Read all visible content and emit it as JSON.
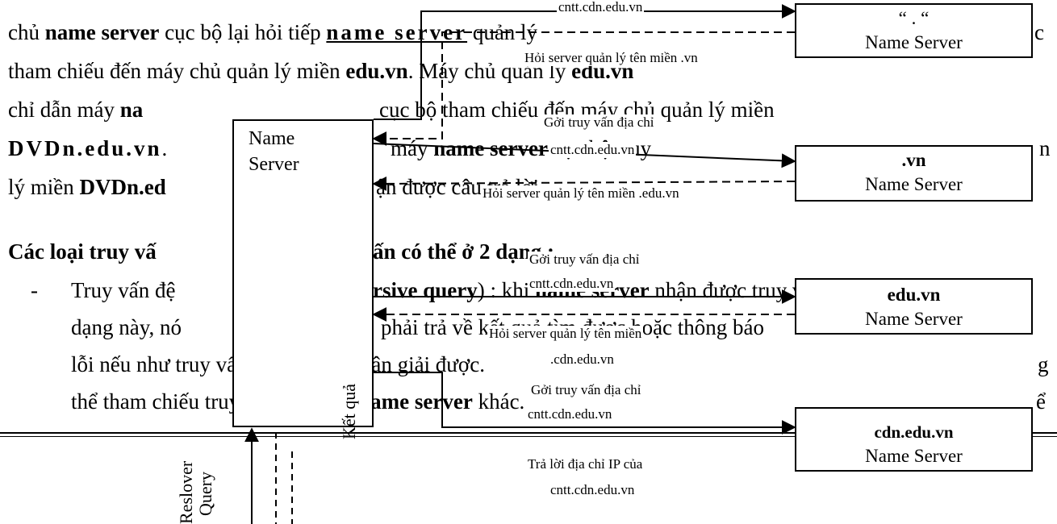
{
  "paragraph": {
    "line1": {
      "a": "chủ ",
      "b": "name server",
      "c": " cục bộ lại hỏi tiếp ",
      "d": "name server",
      "e": " quản lý",
      "f": "c"
    },
    "line2": {
      "a": "tham chiếu đến máy chủ quản lý miền ",
      "b": "edu.vn",
      "c": ". Máy chủ quản lý ",
      "d": "edu.vn"
    },
    "line3": {
      "a": "chỉ dẫn máy ",
      "b": "na",
      "c": "cục bộ tham chiếu đến máy chủ quản lý miền"
    },
    "line4": {
      "a": "DVDn.edu.vn",
      "b": ". ",
      "c": "máy ",
      "d": "name server",
      "e": " cục bộ truy",
      "f": "n"
    },
    "line5": {
      "a": "lý miền ",
      "b": "DVDn.ed",
      "c": "ận được câu trả lời."
    }
  },
  "heading": {
    "a": "Các loại truy vấ",
    "b": "ấn có thể ở 2 dạng :"
  },
  "bullet": {
    "dash": "-",
    "line1": {
      "a": "Truy vấn đệ",
      "b": "rsive query",
      "c": ") : khi ",
      "d": "name server",
      "e": " nhận được truy vấn"
    },
    "line2": {
      "a": "dạng này, nó",
      "b": "phải trả về kết quả tìm được hoặc thông báo"
    },
    "line3": {
      "a": "lỗi nếu như truy vấn này không phân giải được.",
      "b": "g"
    },
    "line4": {
      "a": "thể tham chiếu truy vấn đến một ",
      "b": "name server",
      "c": " khác.",
      "d": "ể"
    }
  },
  "resolver_box": {
    "line1": "Name",
    "line2": "Server"
  },
  "servers": [
    {
      "name": "“ . “",
      "sub": "Name Server",
      "bold": false
    },
    {
      "name": ".vn",
      "sub": "Name Server",
      "bold": true
    },
    {
      "name": "edu.vn",
      "sub": "Name Server",
      "bold": true
    },
    {
      "name": "cdn.edu.vn",
      "sub": "Name Server",
      "bold": true
    }
  ],
  "captions": {
    "c1": "cntt.cdn.edu.vn",
    "c2": "Hỏi server quản lý tên miền .vn",
    "c3": "Gởi truy vấn địa chỉ",
    "c4": "cntt.cdn.edu.vn",
    "c5": "Hỏi server quản lý tên miền .edu.vn",
    "c6": "Gởi truy vấn địa chỉ",
    "c7": "cntt.cdn.edu.vn",
    "c8": "Hỏi server quản lý tên miền",
    "c9": ".cdn.edu.vn",
    "c10": "Gởi truy vấn địa chỉ",
    "c11": "cntt.cdn.edu.vn",
    "c12": "Trả lời địa chỉ IP của",
    "c13": "cntt.cdn.edu.vn"
  },
  "vertical": {
    "resolver": "Reslover",
    "query": "Query",
    "result": "Kết quả"
  }
}
